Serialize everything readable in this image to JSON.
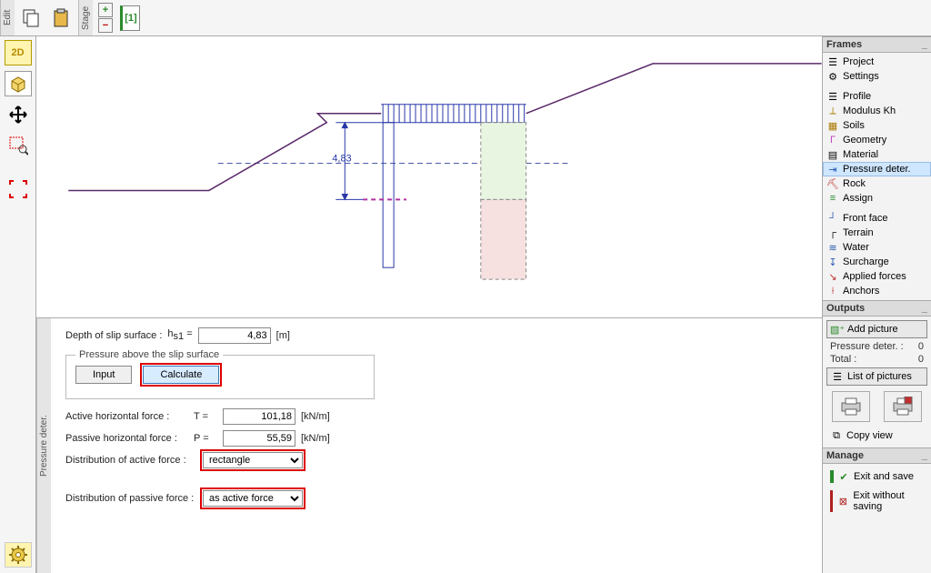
{
  "top": {
    "edit_label": "Edit",
    "stage_label": "Stage",
    "stage_tab": "[1]"
  },
  "left_tools": {
    "view2d": "2D",
    "view3d": "3D"
  },
  "canvas": {
    "dimension_value": "4,83"
  },
  "frames": {
    "title": "Frames",
    "items": [
      "Project",
      "Settings",
      "Profile",
      "Modulus Kh",
      "Soils",
      "Geometry",
      "Material",
      "Pressure deter.",
      "Rock",
      "Assign",
      "Front face",
      "Terrain",
      "Water",
      "Surcharge",
      "Applied forces",
      "Anchors"
    ],
    "selected_index": 7
  },
  "outputs": {
    "title": "Outputs",
    "add_picture": "Add picture",
    "rows": [
      {
        "label": "Pressure deter. :",
        "value": "0"
      },
      {
        "label": "Total :",
        "value": "0"
      }
    ],
    "list_of_pictures": "List of pictures",
    "copy_view": "Copy view"
  },
  "manage": {
    "title": "Manage",
    "exit_save": "Exit and save",
    "exit_nosave": "Exit without saving"
  },
  "bottom": {
    "panel_label": "Pressure deter.",
    "depth_label": "Depth of slip surface :",
    "depth_sym": "h",
    "depth_sub": "s1",
    "depth_eq": "=",
    "depth_value": "4,83",
    "depth_unit": "[m]",
    "fieldset_title": "Pressure above the slip surface",
    "input_btn": "Input",
    "calc_btn": "Calculate",
    "active_label": "Active horizontal force :",
    "active_sym": "T =",
    "active_value": "101,18",
    "active_unit": "[kN/m]",
    "passive_label": "Passive horizontal force :",
    "passive_sym": "P =",
    "passive_value": "55,59",
    "passive_unit": "[kN/m]",
    "dist_active_label": "Distribution of active force :",
    "dist_active_value": "rectangle",
    "dist_passive_label": "Distribution of passive force :",
    "dist_passive_value": "as active force"
  }
}
